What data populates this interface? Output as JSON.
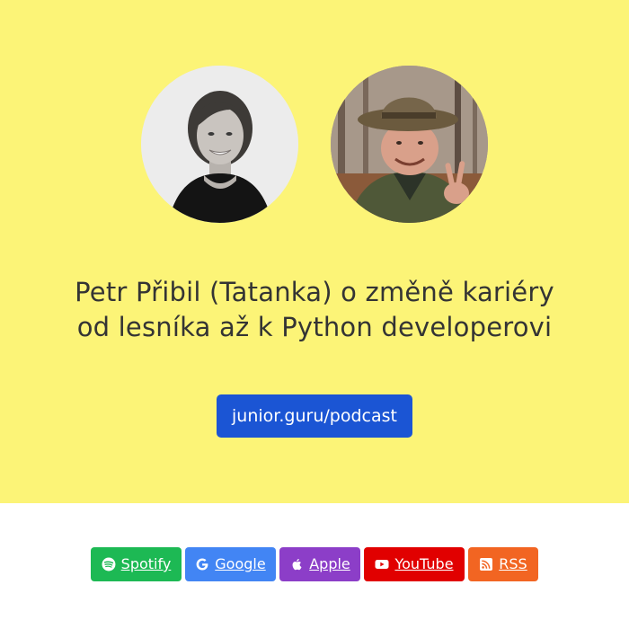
{
  "title_lines": [
    "Petr Přibil (Tatanka) o změně kariéry",
    "od lesníka až k Python developerovi"
  ],
  "cta": {
    "label": "junior.guru/podcast",
    "color": "#1b55d4"
  },
  "background": {
    "hero": "#fcf477",
    "footer": "#ffffff"
  },
  "platforms": [
    {
      "label": "Spotify",
      "icon": "spotify-icon",
      "color": "#1db954"
    },
    {
      "label": "Google",
      "icon": "google-icon",
      "color": "#4285f4"
    },
    {
      "label": "Apple",
      "icon": "apple-icon",
      "color": "#8c3ec8"
    },
    {
      "label": "YouTube",
      "icon": "youtube-icon",
      "color": "#e10000"
    },
    {
      "label": "RSS",
      "icon": "rss-icon",
      "color": "#f26522"
    }
  ]
}
